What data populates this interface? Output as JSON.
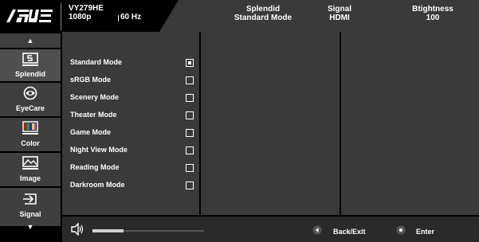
{
  "header": {
    "brand_logo": "/ISUS",
    "model": "VY279HE",
    "resolution": "1080p",
    "refresh_rate": "60 Hz",
    "status": [
      {
        "title": "Splendid",
        "value": "Standard Mode"
      },
      {
        "title": "Signal",
        "value": "HDMI"
      },
      {
        "title": "Btightness",
        "value": "100"
      }
    ]
  },
  "nav": {
    "up_arrow": "▲",
    "down_arrow": "▼",
    "items": [
      {
        "label": "Splendid",
        "icon": "splendid-icon",
        "active": true
      },
      {
        "label": "EyeCare",
        "icon": "eye-icon",
        "active": false
      },
      {
        "label": "Color",
        "icon": "color-icon",
        "active": false
      },
      {
        "label": "Image",
        "icon": "image-icon",
        "active": false
      },
      {
        "label": "Signal",
        "icon": "signal-icon",
        "active": false
      }
    ]
  },
  "menu": {
    "options": [
      {
        "label": "Standard Mode",
        "checked": true
      },
      {
        "label": "sRGB Mode",
        "checked": false
      },
      {
        "label": "Scenery Mode",
        "checked": false
      },
      {
        "label": "Theater Mode",
        "checked": false
      },
      {
        "label": "Game Mode",
        "checked": false
      },
      {
        "label": "Night View Mode",
        "checked": false
      },
      {
        "label": "Reading Mode",
        "checked": false
      },
      {
        "label": "Darkroom Mode",
        "checked": false
      }
    ]
  },
  "footer": {
    "volume_icon": "speaker-icon",
    "volume_level": 0.28,
    "back_label": "Back/Exit",
    "enter_label": "Enter"
  },
  "colors": {
    "background": "#000000",
    "panel": "#3a3a3a",
    "text": "#ffffff"
  }
}
